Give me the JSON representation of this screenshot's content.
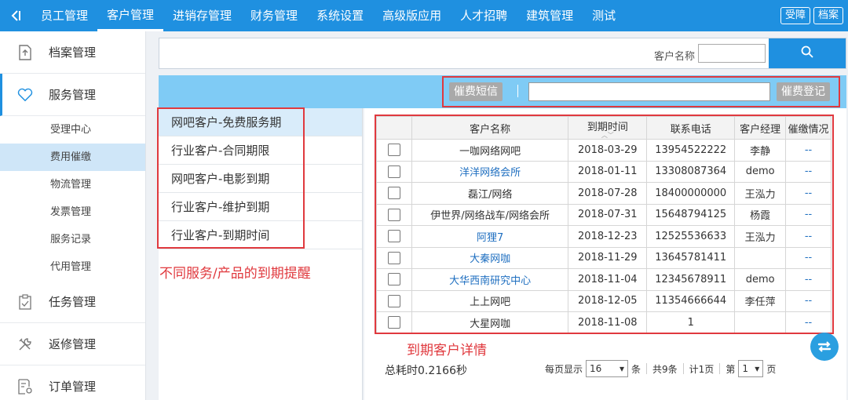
{
  "top_nav": {
    "items": [
      "员工管理",
      "客户管理",
      "进销存管理",
      "财务管理",
      "系统设置",
      "高级版应用",
      "人才招聘",
      "建筑管理",
      "测试"
    ],
    "active_index": 1,
    "right_buttons": [
      "受障",
      "档案"
    ]
  },
  "sidebar": {
    "sections": [
      {
        "label": "档案管理",
        "icon": "file-upload-icon"
      },
      {
        "label": "服务管理",
        "icon": "heart-icon"
      },
      {
        "label": "任务管理",
        "icon": "clipboard-check-icon"
      },
      {
        "label": "返修管理",
        "icon": "tools-icon"
      },
      {
        "label": "订单管理",
        "icon": "order-settings-icon"
      }
    ],
    "sub_items": [
      "受理中心",
      "费用催缴",
      "物流管理",
      "发票管理",
      "服务记录",
      "代用管理"
    ],
    "active_section": "服务管理",
    "active_sub": "费用催缴"
  },
  "search": {
    "label": "客户名称",
    "value": ""
  },
  "action_bar": {
    "sms_button": "催费短信",
    "register_button": "催费登记"
  },
  "categories": [
    "网吧客户-免费服务期",
    "行业客户-合同期限",
    "网吧客户-电影到期",
    "行业客户-维护到期",
    "行业客户-到期时间"
  ],
  "annotations": {
    "left_note": "不同服务/产品的到期提醒",
    "right_note": "到期客户详情"
  },
  "table": {
    "headers": [
      "",
      "客户名称",
      "到期时间",
      "联系电话",
      "客户经理",
      "催缴情况"
    ],
    "rows": [
      {
        "name": "一咖网络网吧",
        "date": "2018-03-29",
        "phone": "13954522222",
        "manager": "李静",
        "status": "--",
        "link": false
      },
      {
        "name": "洋洋网络会所",
        "date": "2018-01-11",
        "phone": "13308087364",
        "manager": "demo",
        "status": "--",
        "link": true
      },
      {
        "name": "磊江/网络",
        "date": "2018-07-28",
        "phone": "18400000000",
        "manager": "王泓力",
        "status": "--",
        "link": false
      },
      {
        "name": "伊世界/网络战车/网络会所",
        "date": "2018-07-31",
        "phone": "15648794125",
        "manager": "杨霞",
        "status": "--",
        "link": false
      },
      {
        "name": "阿狸7",
        "date": "2018-12-23",
        "phone": "12525536633",
        "manager": "王泓力",
        "status": "--",
        "link": true
      },
      {
        "name": "大秦网咖",
        "date": "2018-11-29",
        "phone": "13645781411",
        "manager": "",
        "status": "--",
        "link": true
      },
      {
        "name": "大华西南研究中心",
        "date": "2018-11-04",
        "phone": "12345678911",
        "manager": "demo",
        "status": "--",
        "link": true
      },
      {
        "name": "上上网吧",
        "date": "2018-12-05",
        "phone": "11354666644",
        "manager": "李任萍",
        "status": "--",
        "link": false
      },
      {
        "name": "大星网咖",
        "date": "2018-11-08",
        "phone": "1",
        "manager": "",
        "status": "--",
        "link": false
      }
    ]
  },
  "footer": {
    "elapsed": "总耗时0.2166秒",
    "per_page_label": "每页显示",
    "per_page": "16",
    "unit": "条",
    "total": "共9条",
    "pages": "计1页",
    "page_prefix": "第",
    "page": "1",
    "page_suffix": "页"
  },
  "colors": {
    "primary": "#1f90e0",
    "highlight": "#e0393e",
    "light_blue_bar": "#7fcbf5"
  }
}
